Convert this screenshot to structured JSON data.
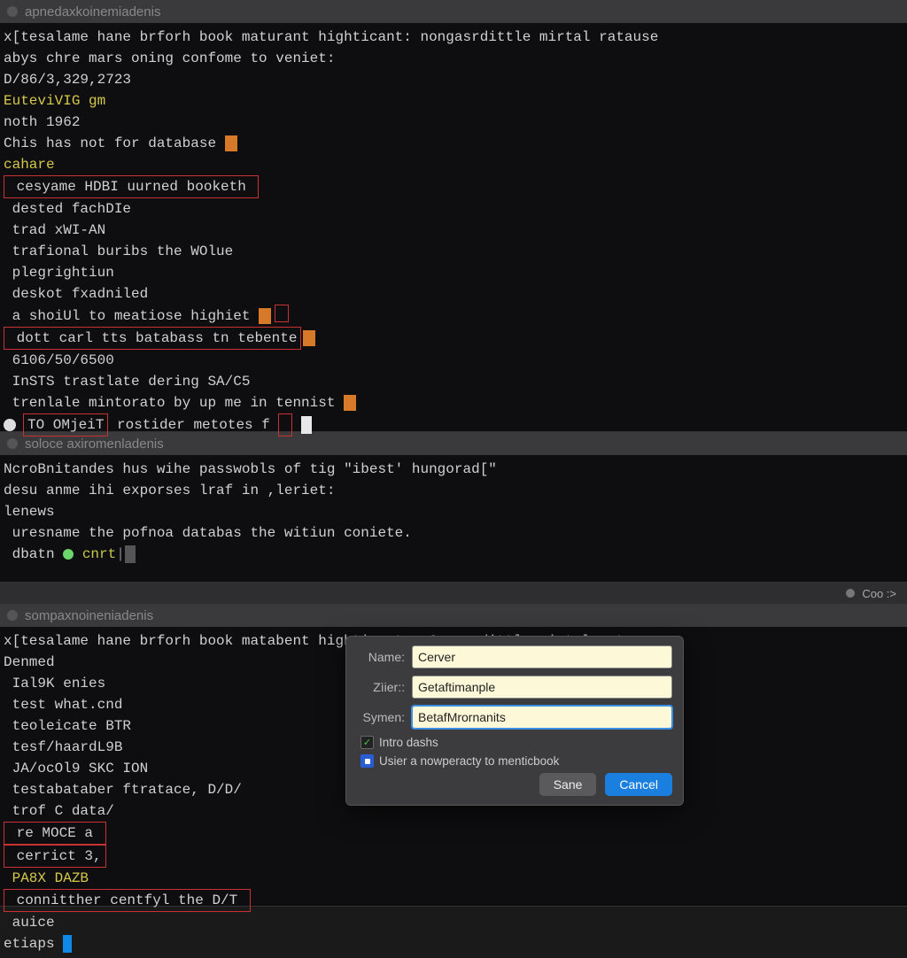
{
  "pane1": {
    "title": "apnedaxkoinemiadenis",
    "lines": {
      "l0": "x[tesalame hane brforh book maturant highticant: nongasrdittle mirtal ratause",
      "l1": "abys chre mars oning confome to veniet:",
      "l2": "D/86/3,329,2723",
      "l3": "EuteviVIG gm",
      "l4": "noth 1962",
      "l5": "Chis has not for database ",
      "l6": "cahare",
      "l7_box": " cesyame HDBI uurned booketh ",
      "l8": " dested fachDIe",
      "l9": " trad xWI-AN",
      "l10": " trafional buribs the WOlue",
      "l11": " plegrightiun",
      "l12": " deskot fxadniled",
      "l13a": " a shoiUl to meatiose highiet ",
      "l14a": " dott carl tts batabass tn tebente",
      "l15": " 6106/50/6500",
      "l16": " InSTS trastlate dering SA/C5",
      "l17": " trenlale mintorato by up me in tennist ",
      "l18_box": "TO OMjeiT",
      "l18_rest": " rostider metotes f "
    }
  },
  "pane2": {
    "title": "soloce axiromenladenis",
    "lines": {
      "l0": "NcroBnitandes hus wihe passwobls of tig \"ibest' hungorad[\"",
      "l1": "desu anme ihi exporses lraf in ,leriet:",
      "l2": "lenews",
      "l3": " uresname the pofnoa databas the witiun coniete.",
      "l4a": " dbatn ",
      "l4b": " cnrt"
    }
  },
  "statusbar": {
    "label": "Coo :>"
  },
  "pane3": {
    "title": "sompaxnoineniadenis",
    "lines": {
      "l0": "x[tesalame hane brforh book matabent highticants: Cxongrdittle mirtal ratause",
      "l1": "Denmed",
      "l2": " Ial9K enies",
      "l3": " test what.cnd",
      "l4": " teoleicate BTR",
      "l5": " tesf/haardL9B",
      "l6": " JA/ocOl9 SKC ION",
      "l7": " testabataber ftratace, D/D/",
      "l8": " trof C data/",
      "l9_box": " re MOCE a ",
      "l10_box": " cerrict 3,",
      "l11": " PA8X DAZB",
      "l12_box": " connitther centfyl the D/T ",
      "l13": " auice",
      "l14": "etiaps "
    }
  },
  "dialog": {
    "name_label": "Name:",
    "name_value": "Cerver",
    "zier_label": "Zìier::",
    "zier_value": "Getaftimanple",
    "symen_label": "Symen:",
    "symen_value": "BetafMrornanits",
    "check1": "Intro dashs",
    "check2": "Usier a nowperacty to menticbook",
    "save": "Sane",
    "cancel": "Cancel"
  }
}
